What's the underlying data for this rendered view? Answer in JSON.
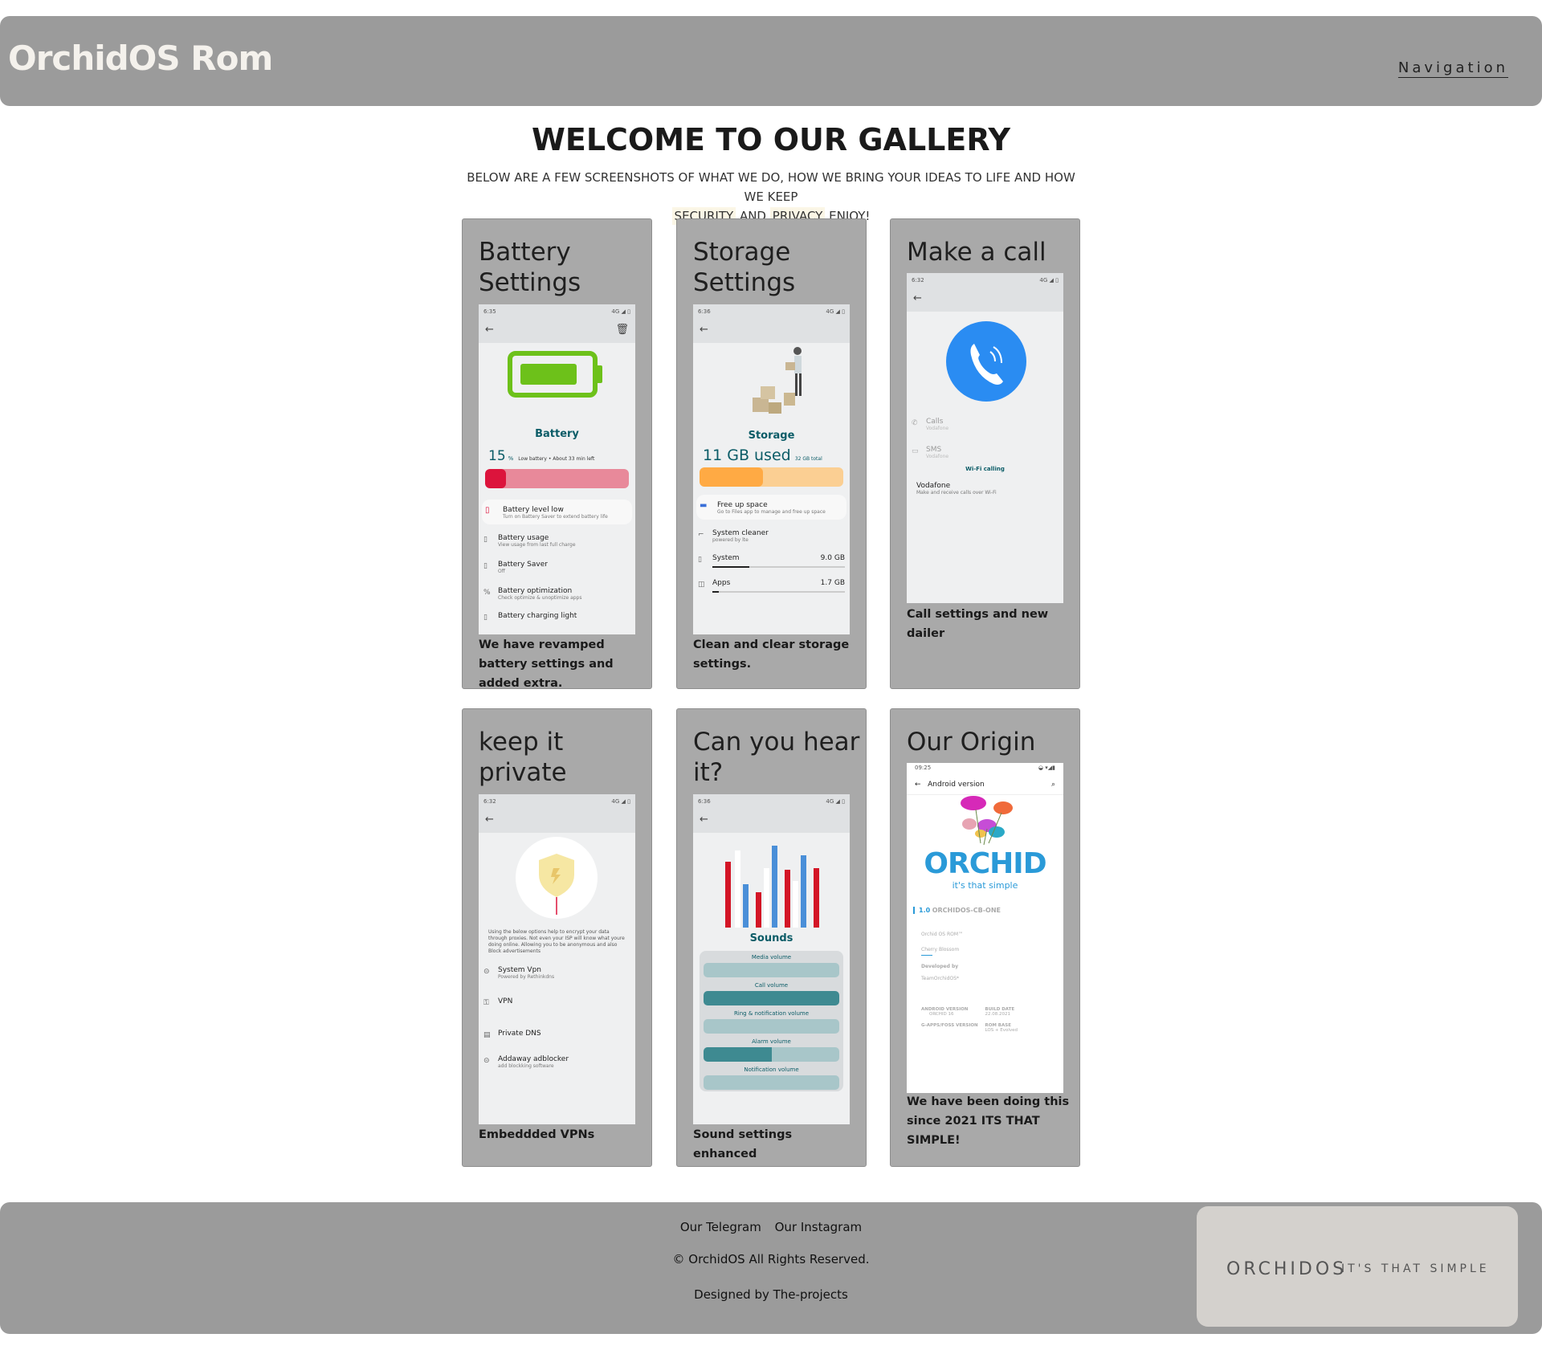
{
  "header": {
    "brand": "OrchidOS Rom",
    "nav_label": "Navigation"
  },
  "gallery": {
    "title": "WELCOME TO OUR GALLERY",
    "intro_before": "BELOW ARE A FEW SCREENSHOTS OF WHAT WE DO, HOW WE BRING YOUR IDEAS TO LIFE AND HOW WE KEEP",
    "intro_security": "SECURITY",
    "intro_and": "AND",
    "intro_privacy": "PRIVACY",
    "intro_after": "ENJOY!"
  },
  "cards": [
    {
      "title": "Battery Settings",
      "caption": "We have revamped battery settings and added extra."
    },
    {
      "title": "Storage Settings",
      "caption": "Clean and clear storage settings."
    },
    {
      "title": "Make a call",
      "caption": "Call settings and new dailer"
    },
    {
      "title": "keep it private",
      "caption": "Embeddded VPNs"
    },
    {
      "title": "Can you hear it?",
      "caption": "Sound settings enhanced"
    },
    {
      "title": "Our Origin",
      "caption": "We have been doing this since 2021 ITS THAT SIMPLE!"
    }
  ],
  "phones": {
    "battery": {
      "time": "6:35",
      "signal": "4G ◢ ▯",
      "heading": "Battery",
      "percent": "15",
      "percent_unit": "%",
      "status": "Low battery • About 33 min left",
      "level_fraction": 0.15,
      "rows": [
        {
          "title": "Battery level low",
          "sub": "Turn on Battery Saver to extend battery life"
        },
        {
          "title": "Battery usage",
          "sub": "View usage from last full charge"
        },
        {
          "title": "Battery Saver",
          "sub": "Off"
        },
        {
          "title": "Battery optimization",
          "sub": "Check optimize & unoptimize apps"
        },
        {
          "title": "Battery charging light",
          "sub": ""
        }
      ]
    },
    "storage": {
      "time": "6:36",
      "signal": "4G ◢ ▯",
      "heading": "Storage",
      "used": "11 GB used",
      "total": "32 GB total",
      "used_fraction": 0.44,
      "rows": [
        {
          "title": "Free up space",
          "sub": "Go to Files app to manage and free up space"
        },
        {
          "title": "System cleaner",
          "sub": "powered by lte"
        }
      ],
      "items": [
        {
          "title": "System",
          "value": "9.0 GB",
          "fraction": 0.28
        },
        {
          "title": "Apps",
          "value": "1.7 GB",
          "fraction": 0.05
        }
      ]
    },
    "call": {
      "time": "6:32",
      "signal": "4G ◢ ▯",
      "rows": [
        {
          "title": "Calls",
          "sub": "Vodafone"
        },
        {
          "title": "SMS",
          "sub": "Vodafone"
        }
      ],
      "wifi_label": "Wi-Fi calling",
      "carrier": "Vodafone",
      "carrier_sub": "Make and receive calls over Wi-Fi"
    },
    "private": {
      "time": "6:32",
      "signal": "4G ◢ ▯",
      "description": "Using the below options help to encrypt your data through proxies. Not even your ISP will know what youre doing online. Allowing you to be anonymous and also Block advertisements",
      "rows": [
        {
          "title": "System Vpn",
          "sub": "Powered by Rethinkdns"
        },
        {
          "title": "VPN",
          "sub": ""
        },
        {
          "title": "Private DNS",
          "sub": ""
        },
        {
          "title": "Addaway adblocker",
          "sub": "add blockking software"
        }
      ]
    },
    "sounds": {
      "time": "6:36",
      "signal": "4G ◢ ▯",
      "heading": "Sounds",
      "sliders": [
        {
          "label": "Media volume",
          "level": 0.0
        },
        {
          "label": "Call volume",
          "level": 1.0
        },
        {
          "label": "Ring & notification volume",
          "level": 0.0
        },
        {
          "label": "Alarm volume",
          "level": 0.5
        },
        {
          "label": "Notification volume",
          "level": 0.0
        }
      ]
    },
    "origin": {
      "time": "09:25",
      "top_title": "Android version",
      "logo": "ORCHID",
      "tagline": "it's that simple",
      "version": "1.0",
      "codename": "ORCHIDOS-CB-ONE",
      "lines": [
        "Orchid OS ROM™",
        "Cherry Blossom",
        "Developed by",
        "TeamOrchidOS*"
      ],
      "grid": [
        {
          "label": "ANDROID VERSION",
          "value": "ORCHID 16"
        },
        {
          "label": "BUILD DATE",
          "value": "22.08.2021"
        },
        {
          "label": "G-APPS/FOSS VERSION",
          "value": ""
        },
        {
          "label": "ROM BASE",
          "value": "LOS + Evolved"
        }
      ]
    }
  },
  "footer": {
    "telegram": "Our Telegram",
    "instagram": "Our Instagram",
    "copyright": "© OrchidOS All Rights Reserved.",
    "designed": "Designed by The-projects",
    "badge_big": "ORCHIDOS",
    "badge_small": "IT'S THAT SIMPLE"
  },
  "colors": {
    "header_bg": "#9b9b9b",
    "card_bg": "#a9a9a9",
    "accent_teal": "#0b5c67",
    "battery_red": "#dc143c",
    "storage_orange": "#ffaa44",
    "call_blue": "#2a8cf2"
  }
}
